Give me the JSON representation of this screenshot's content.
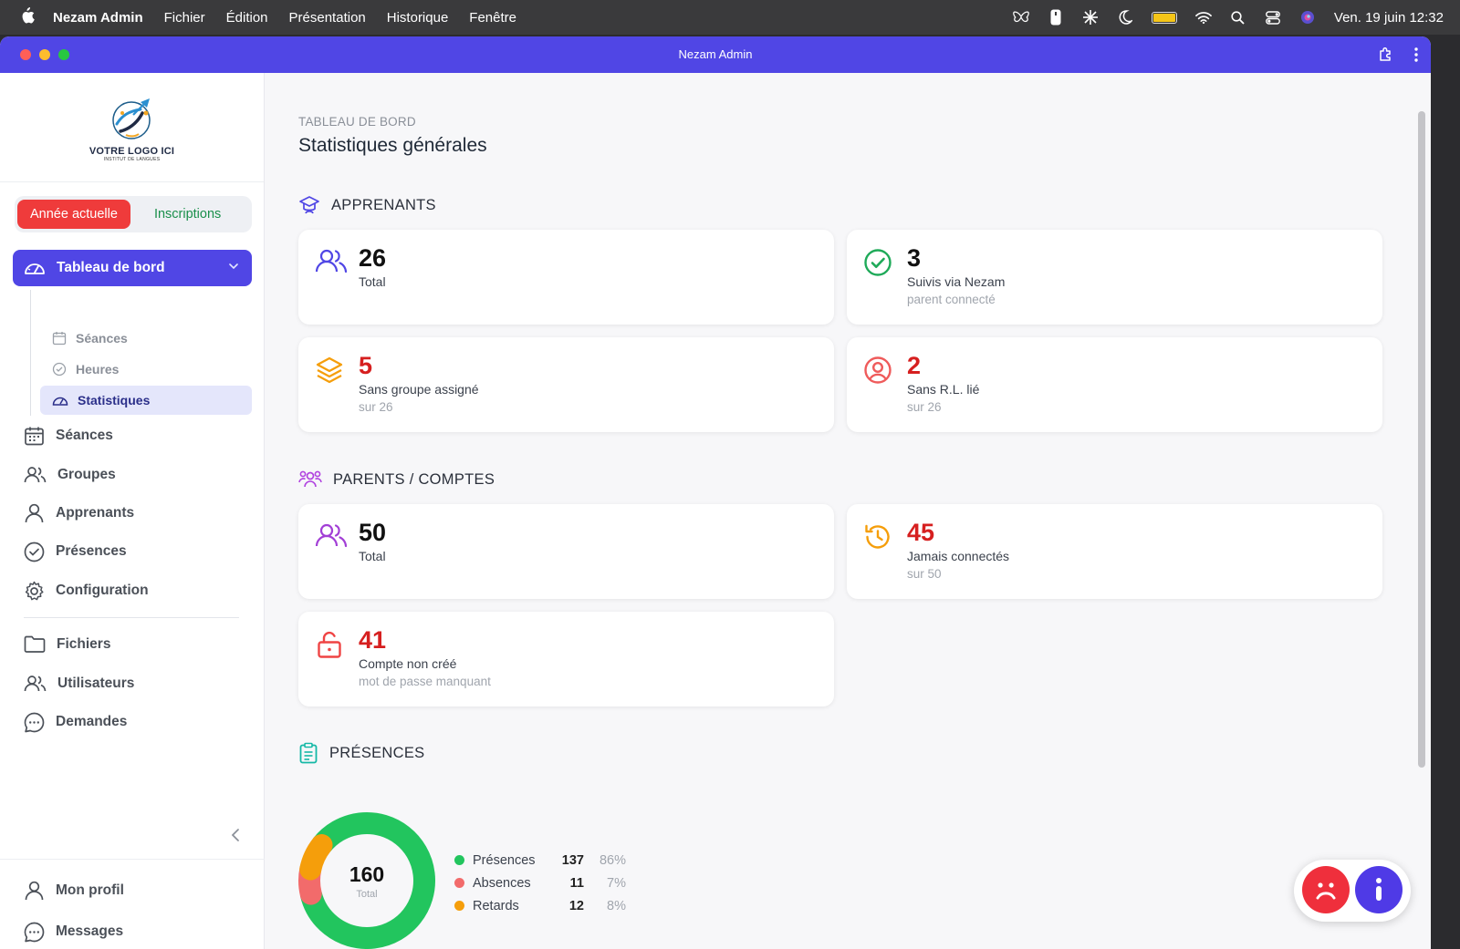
{
  "menubar": {
    "app": "Nezam Admin",
    "items": [
      "Fichier",
      "Édition",
      "Présentation",
      "Historique",
      "Fenêtre"
    ],
    "clock": "Ven. 19 juin  12:32"
  },
  "window": {
    "title": "Nezam Admin"
  },
  "logo": {
    "text": "VOTRE LOGO ICI",
    "subtext": "INSTITUT DE LANGUES"
  },
  "toggle": {
    "active": "Année actuelle",
    "inactive": "Inscriptions"
  },
  "nav": {
    "dashboard": "Tableau de bord",
    "sub": {
      "seances": "Séances",
      "heures": "Heures",
      "statistiques": "Statistiques"
    },
    "seances": "Séances",
    "groupes": "Groupes",
    "apprenants": "Apprenants",
    "presences": "Présences",
    "configuration": "Configuration",
    "fichiers": "Fichiers",
    "utilisateurs": "Utilisateurs",
    "demandes": "Demandes",
    "profil": "Mon profil",
    "messages": "Messages"
  },
  "page": {
    "breadcrumb": "TABLEAU DE BORD",
    "title": "Statistiques générales"
  },
  "sections": {
    "apprenants": {
      "title": "APPRENANTS",
      "total": {
        "value": "26",
        "label": "Total"
      },
      "suivis": {
        "value": "3",
        "label": "Suivis via Nezam",
        "sub": "parent connecté"
      },
      "sans_groupe": {
        "value": "5",
        "label": "Sans groupe assigné",
        "sub": "sur 26"
      },
      "sans_rl": {
        "value": "2",
        "label": "Sans R.L. lié",
        "sub": "sur 26"
      }
    },
    "parents": {
      "title": "PARENTS / COMPTES",
      "total": {
        "value": "50",
        "label": "Total"
      },
      "jamais": {
        "value": "45",
        "label": "Jamais connectés",
        "sub": "sur 50"
      },
      "non_cree": {
        "value": "41",
        "label": "Compte non créé",
        "sub": "mot de passe manquant"
      }
    },
    "presences": {
      "title": "PRÉSENCES",
      "total_value": "160",
      "total_label": "Total"
    }
  },
  "chart_data": {
    "type": "pie",
    "center_value": 160,
    "center_label": "Total",
    "categories": [
      "Présences",
      "Absences",
      "Retards"
    ],
    "values": [
      137,
      11,
      12
    ],
    "percents": [
      "86%",
      "7%",
      "8%"
    ],
    "colors": [
      "#22c55e",
      "#f26b6b",
      "#f59e0b"
    ]
  },
  "colors": {
    "accent": "#5046e5",
    "danger": "#d61f1f",
    "success": "#1a8f4b"
  }
}
